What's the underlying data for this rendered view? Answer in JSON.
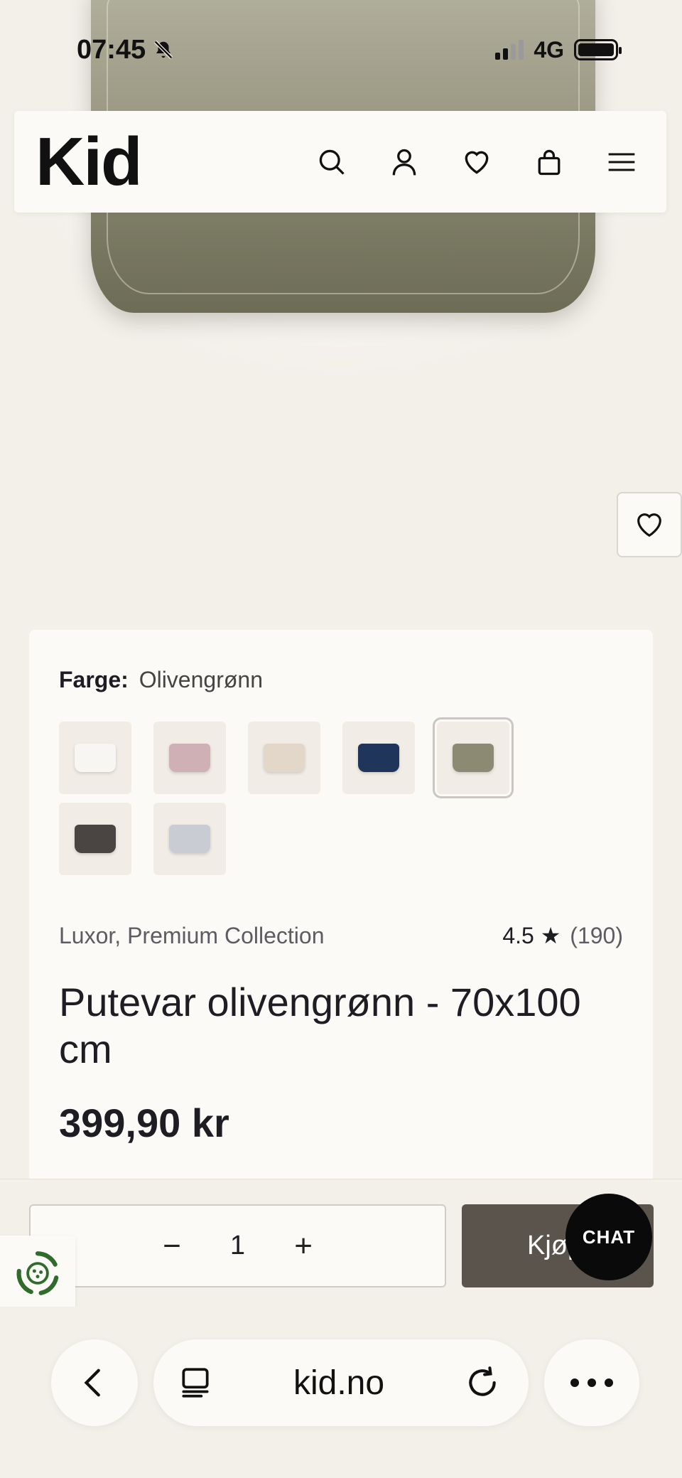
{
  "status_bar": {
    "time": "07:45",
    "network": "4G",
    "icons": [
      "bell-slash-icon",
      "signal-icon",
      "battery-icon"
    ]
  },
  "header": {
    "logo": "Kid",
    "icons": [
      "search-icon",
      "account-icon",
      "wishlist-icon",
      "cart-icon",
      "menu-icon"
    ]
  },
  "product": {
    "color_label": "Farge:",
    "color_value": "Olivengrønn",
    "swatches": [
      {
        "name": "white",
        "color": "#f7f6f3"
      },
      {
        "name": "rose",
        "color": "#cfb0b4"
      },
      {
        "name": "champagne",
        "color": "#e2d7c9"
      },
      {
        "name": "navy",
        "color": "#1f3559"
      },
      {
        "name": "olive",
        "color": "#8c8a73",
        "selected": true
      },
      {
        "name": "charcoal",
        "color": "#4a4442"
      },
      {
        "name": "silver",
        "color": "#c9cdd3"
      }
    ],
    "brand": "Luxor, Premium Collection",
    "rating": "4.5",
    "rating_star": "★",
    "review_count": "(190)",
    "title": "Putevar olivengrønn - 70x100 cm",
    "price": "399,90 kr"
  },
  "purchase": {
    "decrement": "−",
    "quantity": "1",
    "increment": "+",
    "buy_label": "Kjøp",
    "chat_label": "CHAT"
  },
  "browser": {
    "domain": "kid.no"
  },
  "colors": {
    "background": "#f3f0ea",
    "card": "#fbfaf7",
    "buy_button": "#5a544d",
    "chat_button": "#0a0a0a"
  }
}
